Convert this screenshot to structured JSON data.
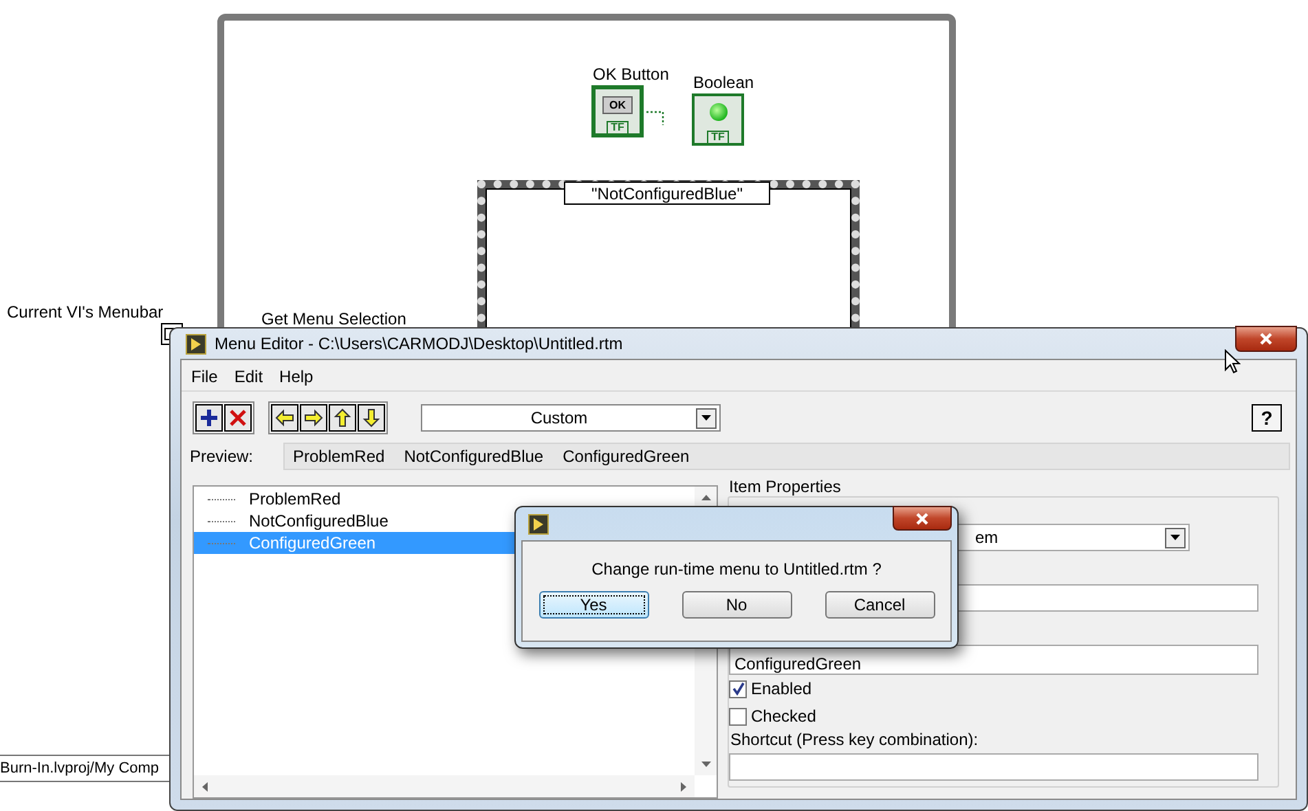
{
  "diagram": {
    "menubar_label": "Current VI's Menubar",
    "get_menu_selection_label": "Get Menu Selection",
    "ok_button": {
      "label": "OK Button",
      "caption": "OK",
      "type_text": "TF"
    },
    "boolean": {
      "label": "Boolean",
      "type_text": "TF",
      "on": true
    },
    "case_selector": "\"NotConfiguredBlue\"",
    "project_status": "Burn-In.lvproj/My Comp"
  },
  "menu_editor": {
    "title": "Menu Editor - C:\\Users\\CARMODJ\\Desktop\\Untitled.rtm",
    "menu": [
      "File",
      "Edit",
      "Help"
    ],
    "menu_type": "Custom",
    "help_button": "?",
    "preview_label": "Preview:",
    "preview_items": [
      "ProblemRed",
      "NotConfiguredBlue",
      "ConfiguredGreen"
    ],
    "tree": [
      {
        "label": "ProblemRed",
        "selected": false
      },
      {
        "label": "NotConfiguredBlue",
        "selected": false
      },
      {
        "label": "ConfiguredGreen",
        "selected": true
      }
    ],
    "properties": {
      "title": "Item Properties",
      "item_type_value": "em",
      "name_value": "ConfiguredGreen",
      "options": [
        {
          "label": "Enabled",
          "checked": true
        },
        {
          "label": "Checked",
          "checked": false
        }
      ],
      "shortcut_label": "Shortcut (Press key combination):"
    }
  },
  "dialog": {
    "message": "Change run-time menu to Untitled.rtm ?",
    "buttons": [
      {
        "label": "Yes",
        "selected": true
      },
      {
        "label": "No",
        "selected": false
      },
      {
        "label": "Cancel",
        "selected": false
      }
    ]
  }
}
